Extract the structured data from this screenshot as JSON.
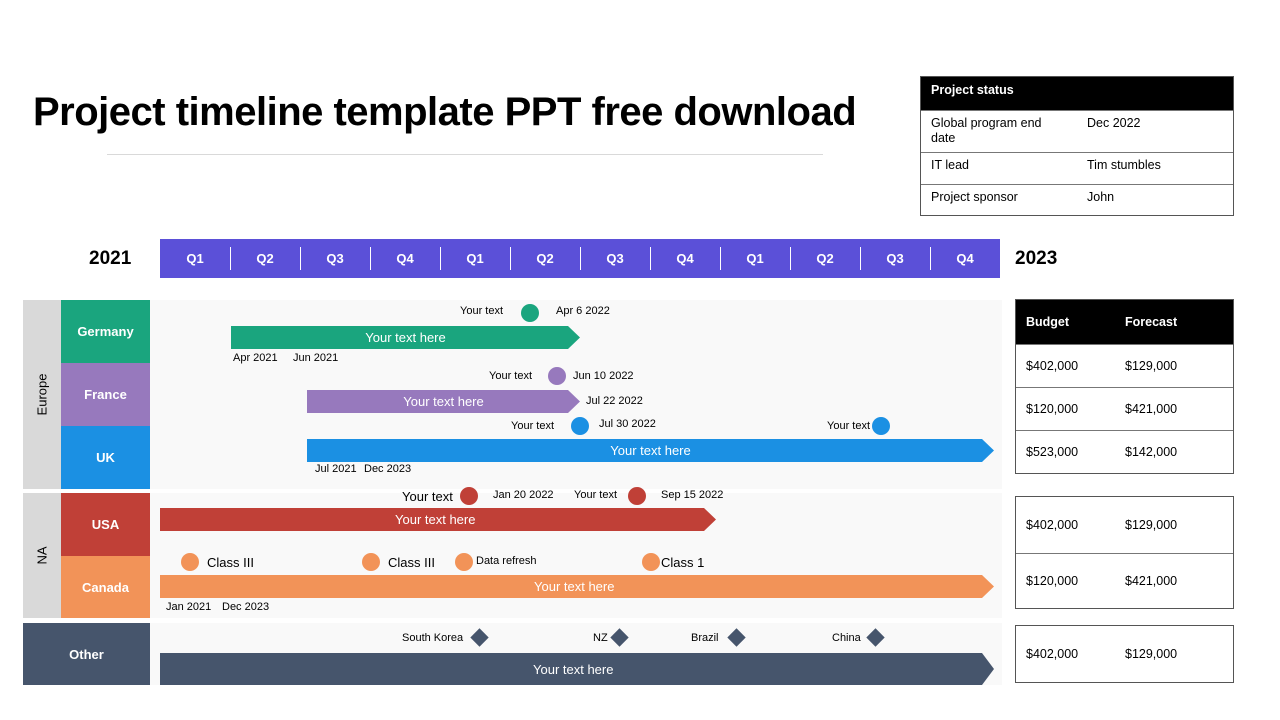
{
  "title": "Project timeline template PPT free download",
  "status_table": {
    "header": "Project status",
    "rows": [
      {
        "key": "Global program  end date",
        "value": "Dec 2022"
      },
      {
        "key": "IT lead",
        "value": "Tim stumbles"
      },
      {
        "key": "Project sponsor",
        "value": "John"
      }
    ]
  },
  "timeline": {
    "start_year": "2021",
    "end_year": "2023",
    "quarters": [
      "Q1",
      "Q2",
      "Q3",
      "Q4",
      "Q1",
      "Q2",
      "Q3",
      "Q4",
      "Q1",
      "Q2",
      "Q3",
      "Q4"
    ]
  },
  "colors": {
    "quarter_bar": "#5b50d8",
    "germany": "#1aa57e",
    "france": "#9779bd",
    "uk": "#1b90e3",
    "usa": "#c04037",
    "canada": "#f29358",
    "other": "#46556c"
  },
  "regions": {
    "europe": "Europe",
    "na": "NA",
    "other": "Other"
  },
  "rows": {
    "germany": {
      "label": "Germany",
      "bar_text": "Your text here",
      "milestone_text": "Your text",
      "milestone_date": "Apr 6 2022",
      "start": "Apr 2021",
      "end": "Jun 2021"
    },
    "france": {
      "label": "France",
      "bar_text": "Your text here",
      "milestone_text": "Your text",
      "milestone_date": "Jun 10 2022",
      "end_date": "Jul 22 2022"
    },
    "uk": {
      "label": "UK",
      "bar_text": "Your text here",
      "milestone1_text": "Your text",
      "milestone1_date": "Jul 30 2022",
      "milestone2_text": "Your text",
      "start": "Jul 2021",
      "end": "Dec 2023"
    },
    "usa": {
      "label": "USA",
      "bar_text": "Your text here",
      "milestone1_text": "Your text",
      "milestone1_date": "Jan 20 2022",
      "milestone2_text": "Your text",
      "milestone2_date": "Sep 15 2022"
    },
    "canada": {
      "label": "Canada",
      "bar_text": "Your text here",
      "milestones": [
        "Class III",
        "Class III",
        "Data refresh",
        "Class 1"
      ],
      "start": "Jan 2021",
      "end": "Dec 2023"
    },
    "other": {
      "label": "Other",
      "bar_text": "Your text here",
      "milestones": [
        "South Korea",
        "NZ",
        "Brazil",
        "China"
      ]
    }
  },
  "finance": {
    "headers": [
      "Budget",
      "Forecast"
    ],
    "europe": [
      {
        "budget": "$402,000",
        "forecast": "$129,000"
      },
      {
        "budget": "$120,000",
        "forecast": "$421,000"
      },
      {
        "budget": "$523,000",
        "forecast": "$142,000"
      }
    ],
    "na": [
      {
        "budget": "$402,000",
        "forecast": "$129,000"
      },
      {
        "budget": "$120,000",
        "forecast": "$421,000"
      }
    ],
    "other": [
      {
        "budget": "$402,000",
        "forecast": "$129,000"
      }
    ]
  }
}
